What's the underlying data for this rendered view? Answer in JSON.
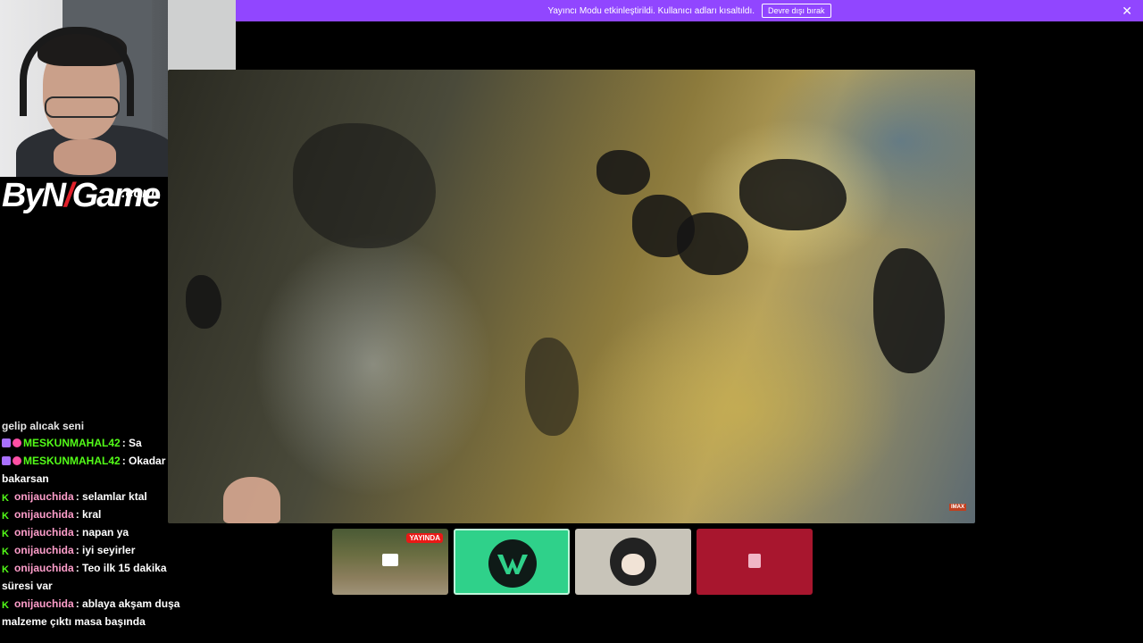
{
  "banner": {
    "text": "Yayıncı Modu etkinleştirildi. Kullanıcı adları kısaltıldı.",
    "button_label": "Devre dışı bırak",
    "close_glyph": "✕",
    "color": "#9146ff"
  },
  "logo": {
    "text_a": "ByN",
    "text_slash": "/",
    "text_b": "Game",
    "suffix": ".com"
  },
  "video": {
    "watermark": "IMAX"
  },
  "chat": {
    "truncated_line": "gelip alıcak seni",
    "messages": [
      {
        "user": "MESKUNMAHAL42",
        "text": ": Sa",
        "color": "#53fc18",
        "badges": [
          "sub1",
          "sub2"
        ]
      },
      {
        "user": "MESKUNMAHAL42",
        "text": ": Okadar bakarsan",
        "color": "#53fc18",
        "badges": [
          "sub1",
          "sub2"
        ]
      },
      {
        "user": "onijauchida",
        "text": ": selamlar ktal",
        "color": "#ff9ecb",
        "badges": [
          "kick"
        ]
      },
      {
        "user": "onijauchida",
        "text": ": kral",
        "color": "#ff9ecb",
        "badges": [
          "kick"
        ]
      },
      {
        "user": "onijauchida",
        "text": ": napan ya",
        "color": "#ff9ecb",
        "badges": [
          "kick"
        ]
      },
      {
        "user": "onijauchida",
        "text": ": iyi seyirler",
        "color": "#ff9ecb",
        "badges": [
          "kick"
        ]
      },
      {
        "user": "onijauchida",
        "text": ": Teo ilk 15 dakika süresi var",
        "color": "#ff9ecb",
        "badges": [
          "kick"
        ]
      },
      {
        "user": "onijauchida",
        "text": ": ablaya akşam duşa malzeme çıktı masa başında",
        "color": "#ff9ecb",
        "badges": [
          "kick"
        ]
      }
    ]
  },
  "squad": {
    "live_label": "YAYINDA",
    "accent": "#2fd18a"
  }
}
